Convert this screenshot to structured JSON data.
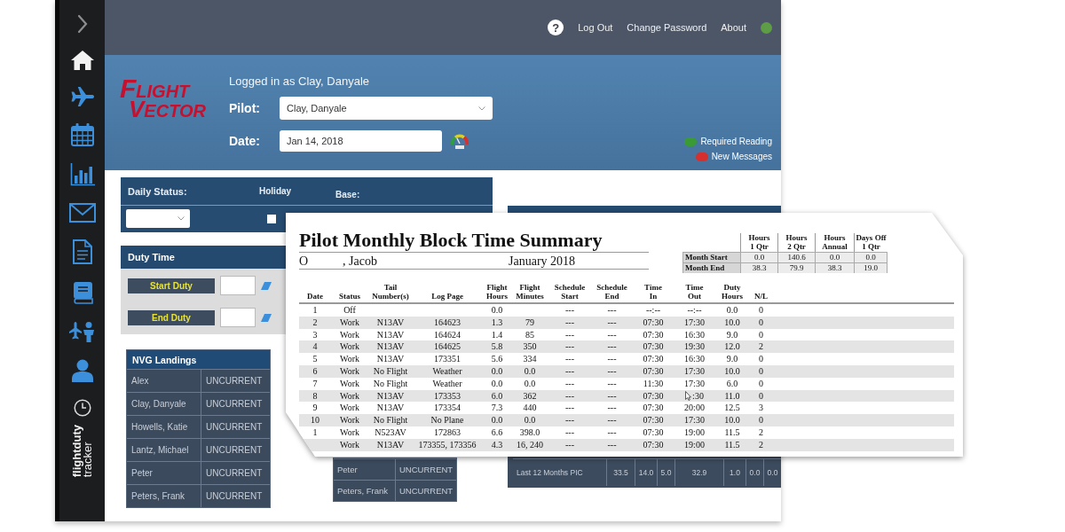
{
  "header": {
    "help": "?",
    "nav": [
      {
        "label": "Log Out"
      },
      {
        "label": "Change Password"
      },
      {
        "label": "About"
      }
    ],
    "online": true
  },
  "sidebar_logo": {
    "line1": "flightduty",
    "line2": "tracker"
  },
  "banner": {
    "logo": {
      "line1": "FLIGHT",
      "line2": "VECTOR"
    },
    "logged_in": "Logged in as Clay, Danyale",
    "pilot": {
      "label": "Pilot:",
      "value": "Clay, Danyale"
    },
    "date": {
      "label": "Date:",
      "value": "Jan 14, 2018"
    },
    "notices": [
      {
        "label": "Required Reading",
        "color": "#3a9a35"
      },
      {
        "label": "New Messages",
        "color": "#d5302d"
      }
    ]
  },
  "daily_status": {
    "title": "Daily Status:",
    "holiday": {
      "label": "Holiday",
      "checked": false
    },
    "base": {
      "label": "Base:"
    }
  },
  "duty_time": {
    "title": "Duty Time",
    "actions": [
      {
        "label": "Start Duty"
      },
      {
        "label": "End Duty"
      }
    ]
  },
  "nvg_landings": {
    "title": "NVG Landings",
    "rows": [
      {
        "name": "Alex",
        "status": "UNCURRENT"
      },
      {
        "name": "Clay, Danyale",
        "status": "UNCURRENT"
      },
      {
        "name": "Howells, Katie",
        "status": "UNCURRENT"
      },
      {
        "name": "Lantz, Michael",
        "status": "UNCURRENT"
      },
      {
        "name": "Peter",
        "status": "UNCURRENT"
      },
      {
        "name": "Peters, Frank",
        "status": "UNCURRENT"
      }
    ]
  },
  "nvg_landings_lower": {
    "rows": [
      {
        "name": "Peter",
        "status": "UNCURRENT"
      },
      {
        "name": "Peters, Frank",
        "status": "UNCURRENT"
      }
    ]
  },
  "stats_panel": {
    "rows": [
      {
        "label": "Last 12 Months PIC",
        "values": [
          "33.5",
          "14.0",
          "5.0",
          "32.9",
          "1.0",
          "0.0",
          "0.0"
        ]
      }
    ]
  },
  "report": {
    "title": "Pilot Monthly Block Time Summary",
    "name_initial": "O",
    "name_rest": ", Jacob",
    "period": "January 2018",
    "totals": {
      "columns": [
        "Hours 1 Qtr",
        "Hours 2 Qtr",
        "Hours Annual",
        "Days Off 1 Qtr"
      ],
      "rows": [
        {
          "label": "Month Start",
          "values": [
            "0.0",
            "140.6",
            "0.0",
            "0.0"
          ]
        },
        {
          "label": "Month End",
          "values": [
            "38.3",
            "79.9",
            "38.3",
            "19.0"
          ]
        }
      ]
    },
    "columns": [
      "Date",
      "Status",
      "Tail Number(s)",
      "Log Page",
      "Flight Hours",
      "Flight Minutes",
      "Schedule Start",
      "Schedule End",
      "Time In",
      "Time Out",
      "Duty Hours",
      "N/L"
    ],
    "rows": [
      {
        "date": "1",
        "status": "Off",
        "flight_hours": "0.0",
        "schedule_start": "---",
        "schedule_end": "---",
        "time_in": "--:--",
        "time_out": "--:--",
        "duty_hours": "0.0",
        "nl": "0",
        "pointer": false
      },
      {
        "date": "2",
        "status": "Work",
        "tail": "N13AV",
        "log_page": "164623",
        "flight_hours": "1.3",
        "flight_minutes": "79",
        "schedule_start": "---",
        "schedule_end": "---",
        "time_in": "07:30",
        "time_out": "17:30",
        "duty_hours": "10.0",
        "nl": "0",
        "pointer": false
      },
      {
        "date": "3",
        "status": "Work",
        "tail": "N13AV",
        "log_page": "164624",
        "flight_hours": "1.4",
        "flight_minutes": "85",
        "schedule_start": "---",
        "schedule_end": "---",
        "time_in": "07:30",
        "time_out": "16:30",
        "duty_hours": "9.0",
        "nl": "0",
        "pointer": false
      },
      {
        "date": "4",
        "status": "Work",
        "tail": "N13AV",
        "log_page": "164625",
        "flight_hours": "5.8",
        "flight_minutes": "350",
        "schedule_start": "---",
        "schedule_end": "---",
        "time_in": "07:30",
        "time_out": "19:30",
        "duty_hours": "12.0",
        "nl": "2",
        "pointer": false
      },
      {
        "date": "5",
        "status": "Work",
        "tail": "N13AV",
        "log_page": "173351",
        "flight_hours": "5.6",
        "flight_minutes": "334",
        "schedule_start": "---",
        "schedule_end": "---",
        "time_in": "07:30",
        "time_out": "16:30",
        "duty_hours": "9.0",
        "nl": "0",
        "pointer": false
      },
      {
        "date": "6",
        "status": "Work",
        "tail": "No Flight",
        "log_page": "Weather",
        "flight_hours": "0.0",
        "flight_minutes": "0.0",
        "schedule_start": "---",
        "schedule_end": "---",
        "time_in": "07:30",
        "time_out": "17:30",
        "duty_hours": "10.0",
        "nl": "0",
        "pointer": false
      },
      {
        "date": "7",
        "status": "Work",
        "tail": "No Flight",
        "log_page": "Weather",
        "flight_hours": "0.0",
        "flight_minutes": "0.0",
        "schedule_start": "---",
        "schedule_end": "---",
        "time_in": "11:30",
        "time_out": "17:30",
        "duty_hours": "6.0",
        "nl": "0",
        "pointer": false
      },
      {
        "date": "8",
        "status": "Work",
        "tail": "N13AV",
        "log_page": "173353",
        "flight_hours": "6.0",
        "flight_minutes": "362",
        "schedule_start": "---",
        "schedule_end": "---",
        "time_in": "07:30",
        "time_out": ":30",
        "duty_hours": "11.0",
        "nl": "0",
        "pointer": true
      },
      {
        "date": "9",
        "status": "Work",
        "tail": "N13AV",
        "log_page": "173354",
        "flight_hours": "7.3",
        "flight_minutes": "440",
        "schedule_start": "---",
        "schedule_end": "---",
        "time_in": "07:30",
        "time_out": "20:00",
        "duty_hours": "12.5",
        "nl": "3",
        "pointer": false
      },
      {
        "date": "10",
        "status": "Work",
        "tail": "No Flight",
        "log_page": "No Plane",
        "flight_hours": "0.0",
        "flight_minutes": "0.0",
        "schedule_start": "---",
        "schedule_end": "---",
        "time_in": "07:30",
        "time_out": "17:30",
        "duty_hours": "10.0",
        "nl": "0",
        "pointer": false
      },
      {
        "date": "1",
        "status": "Work",
        "tail": "N523AV",
        "log_page": "172863",
        "flight_hours": "6.6",
        "flight_minutes": "398.0",
        "schedule_start": "---",
        "schedule_end": "---",
        "time_in": "07:30",
        "time_out": "19:00",
        "duty_hours": "11.5",
        "nl": "2",
        "pointer": false
      },
      {
        "status": "Work",
        "tail": "N13AV",
        "log_page": "173355, 173356",
        "flight_hours": "4.3",
        "flight_minutes": "16, 240",
        "schedule_start": "---",
        "schedule_end": "---",
        "time_in": "07:30",
        "time_out": "19:00",
        "duty_hours": "11.5",
        "nl": "2",
        "pointer": false
      }
    ]
  }
}
